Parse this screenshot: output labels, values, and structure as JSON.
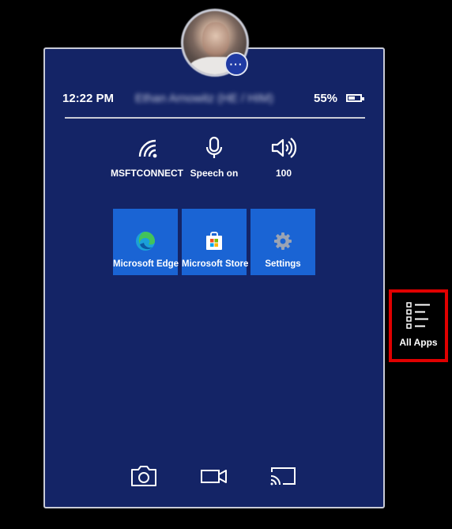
{
  "status": {
    "time": "12:22 PM",
    "user_name": "Ethan Arnowitz (HE / HIM)",
    "battery_percent": "55%",
    "battery_level": 0.55
  },
  "quick_settings": [
    {
      "label": "MSFTCONNECT",
      "icon": "wifi-icon"
    },
    {
      "label": "Speech on",
      "icon": "microphone-icon"
    },
    {
      "label": "100",
      "icon": "volume-icon"
    }
  ],
  "tiles": [
    {
      "label": "Microsoft Edge",
      "icon": "edge-icon"
    },
    {
      "label": "Microsoft Store",
      "icon": "store-icon"
    },
    {
      "label": "Settings",
      "icon": "gear-icon"
    }
  ],
  "more_button": "···",
  "all_apps": {
    "label": "All Apps",
    "icon": "all-apps-list-icon"
  },
  "bottom_bar": [
    {
      "icon": "camera-icon"
    },
    {
      "icon": "video-camera-icon"
    },
    {
      "icon": "cast-icon"
    }
  ],
  "colors": {
    "panel_bg": "#142466",
    "tile_bg": "#1a64d4",
    "highlight_border": "#e00000"
  }
}
